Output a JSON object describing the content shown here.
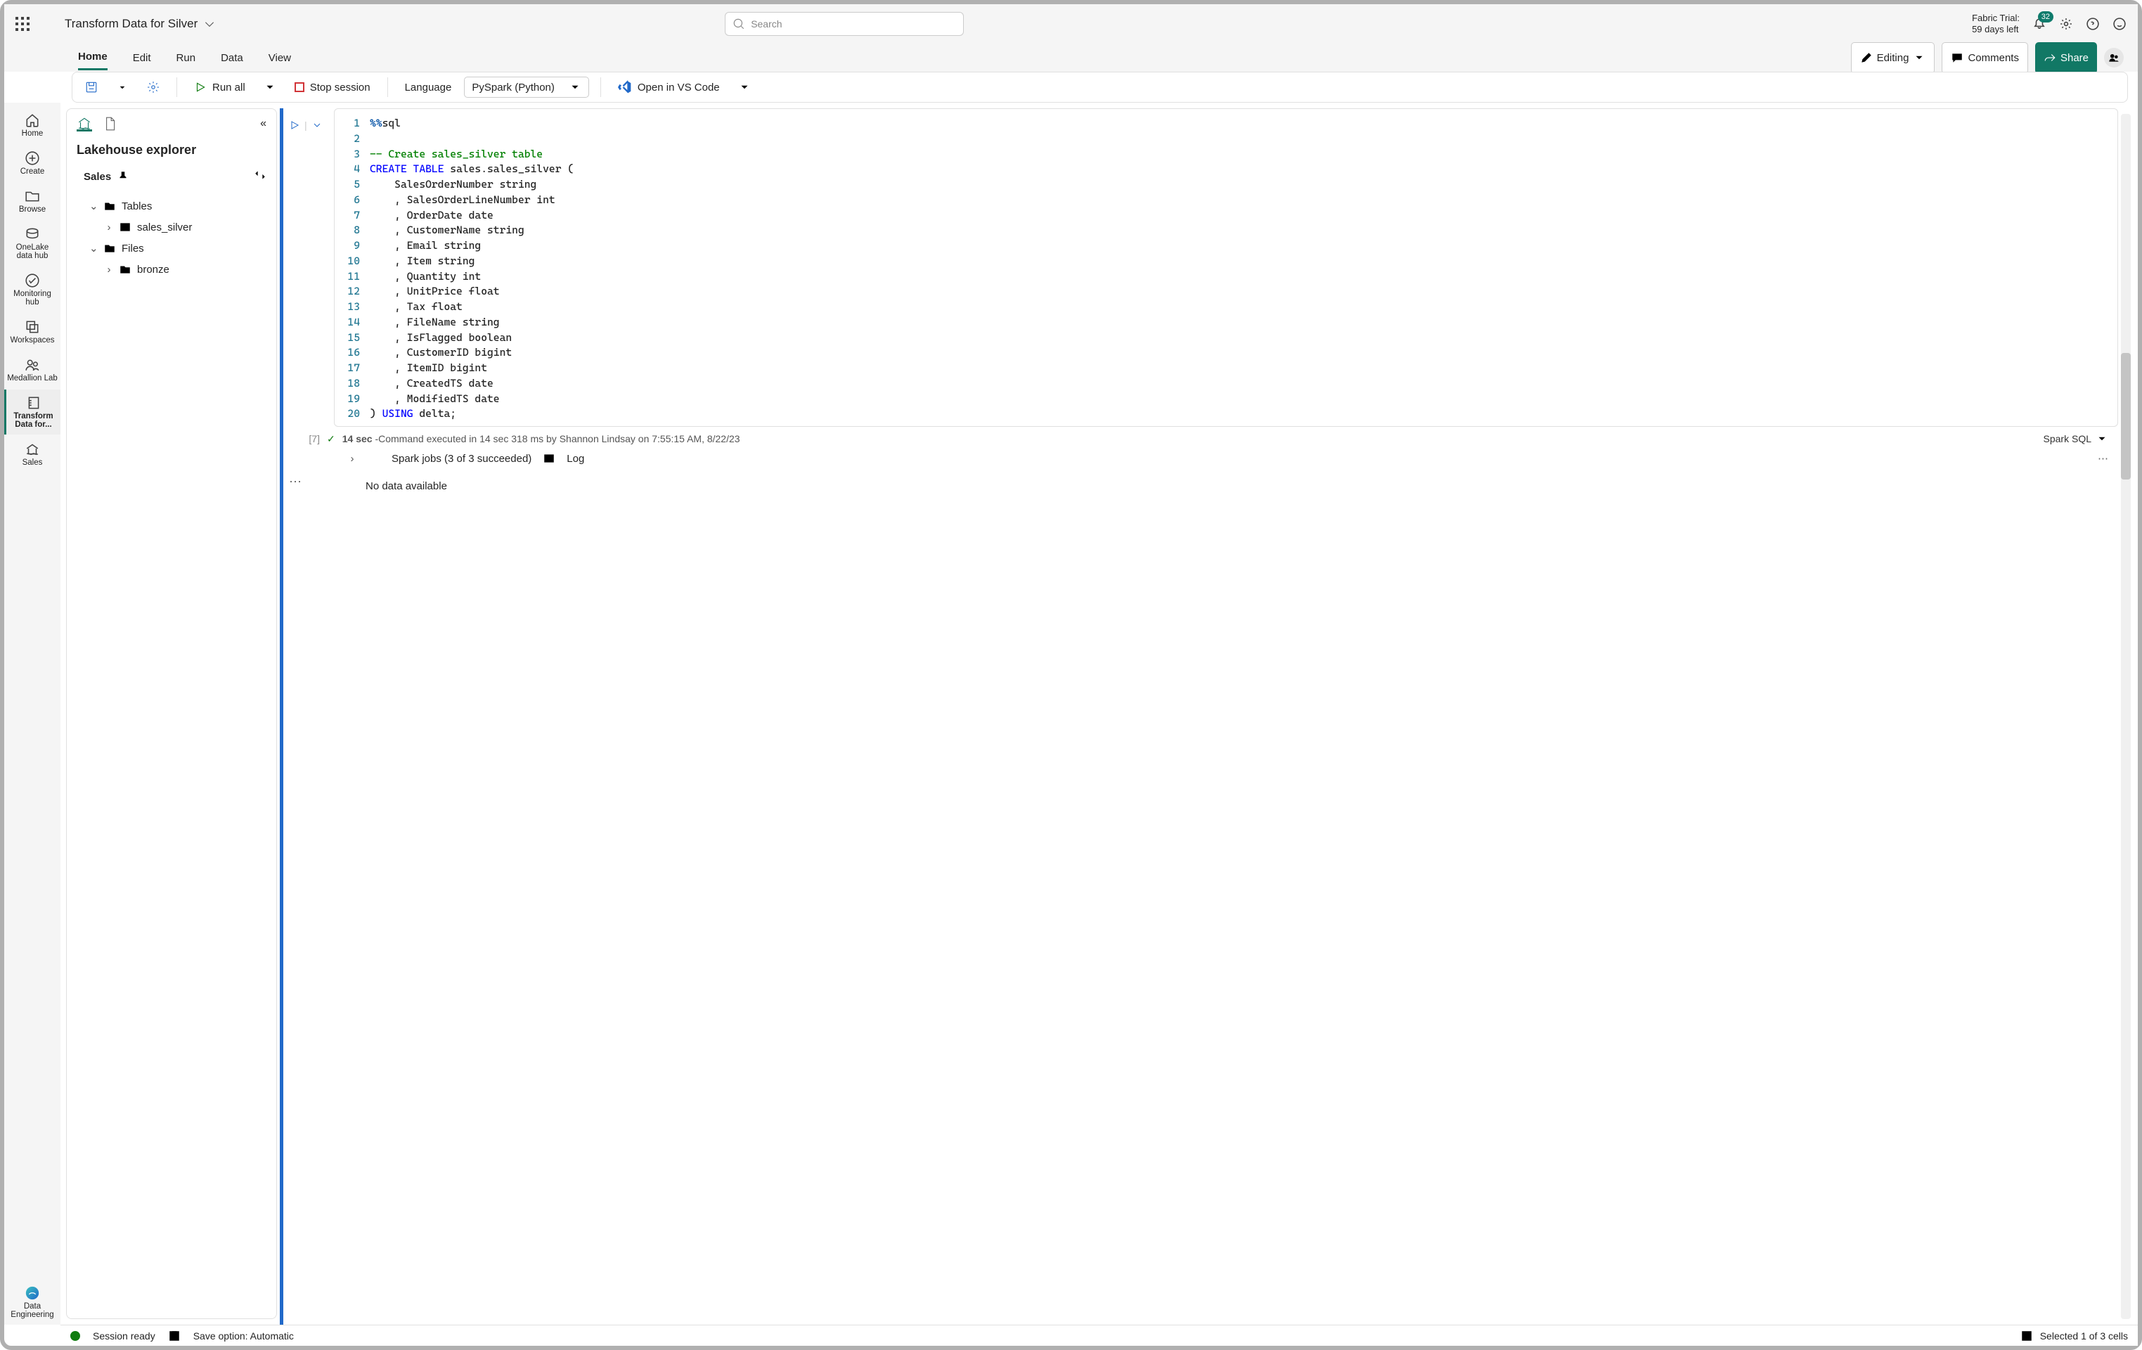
{
  "header": {
    "doc_title": "Transform Data for Silver",
    "search_placeholder": "Search",
    "trial_line1": "Fabric Trial:",
    "trial_line2": "59 days left",
    "notification_count": "32"
  },
  "menubar": {
    "tabs": [
      "Home",
      "Edit",
      "Run",
      "Data",
      "View"
    ],
    "editing": "Editing",
    "comments": "Comments",
    "share": "Share"
  },
  "toolbar": {
    "run_all": "Run all",
    "stop_session": "Stop session",
    "language_label": "Language",
    "language_value": "PySpark (Python)",
    "open_vs": "Open in VS Code"
  },
  "rail": {
    "home": "Home",
    "create": "Create",
    "browse": "Browse",
    "onelake": "OneLake data hub",
    "monitoring": "Monitoring hub",
    "workspaces": "Workspaces",
    "medallion": "Medallion Lab",
    "transform": "Transform Data for...",
    "sales": "Sales",
    "persona": "Data Engineering"
  },
  "explorer": {
    "title": "Lakehouse explorer",
    "db": "Sales",
    "nodes": {
      "tables": "Tables",
      "sales_silver": "sales_silver",
      "files": "Files",
      "bronze": "bronze"
    }
  },
  "cell": {
    "counter": "[7]",
    "status_time": "14 sec",
    "status_text": " -Command executed in 14 sec 318 ms by Shannon Lindsay on 7:55:15 AM, 8/22/23",
    "spark_lang": "Spark SQL",
    "spark_jobs": "Spark jobs (3 of 3 succeeded)",
    "log": "Log",
    "no_data": "No data available",
    "code": {
      "l1_magic": "%%",
      "l1_sql": "sql",
      "l3": "-- Create sales_silver table",
      "l4_kw1": "CREATE",
      "l4_kw2": "TABLE",
      "l4_rest": " sales.sales_silver (",
      "l5": "    SalesOrderNumber string",
      "l6": "    , SalesOrderLineNumber int",
      "l7": "    , OrderDate date",
      "l8": "    , CustomerName string",
      "l9": "    , Email string",
      "l10": "    , Item string",
      "l11": "    , Quantity int",
      "l12": "    , UnitPrice float",
      "l13": "    , Tax float",
      "l14": "    , FileName string",
      "l15": "    , IsFlagged boolean",
      "l16": "    , CustomerID bigint",
      "l17": "    , ItemID bigint",
      "l18": "    , CreatedTS date",
      "l19": "    , ModifiedTS date",
      "l20a": ") ",
      "l20_kw": "USING",
      "l20b": " delta;"
    }
  },
  "statusbar": {
    "session": "Session ready",
    "save": "Save option: Automatic",
    "selected": "Selected 1 of 3 cells"
  }
}
